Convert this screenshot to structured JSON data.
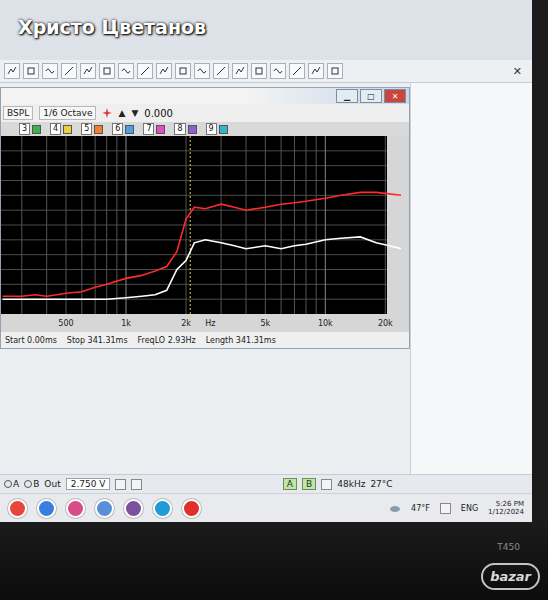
{
  "watermark": {
    "text": "Христо Цветанов"
  },
  "app": {
    "close": "✕"
  },
  "graph_window": {
    "controls": [
      "▁",
      "□",
      "✕"
    ],
    "toolbar": {
      "mode": "BSPL",
      "smoothing": "1/6 Octave",
      "arrows": [
        "▲",
        "▼"
      ],
      "value": "0.000"
    },
    "legend": [
      {
        "label": "3",
        "color": "#3cb44b"
      },
      {
        "label": "4",
        "color": "#e6d23c"
      },
      {
        "label": "5",
        "color": "#f08030"
      },
      {
        "label": "6",
        "color": "#4aa0e8"
      },
      {
        "label": "7",
        "color": "#e050c0"
      },
      {
        "label": "8",
        "color": "#9060d0"
      },
      {
        "label": "9",
        "color": "#30b8c8"
      }
    ],
    "chart": {
      "ticks": [
        {
          "label": "500",
          "hz": 500
        },
        {
          "label": "1k",
          "hz": 1000
        },
        {
          "label": "2k",
          "hz": 2000
        },
        {
          "label": "Hz",
          "hz": 2650
        },
        {
          "label": "5k",
          "hz": 5000
        },
        {
          "label": "10k",
          "hz": 10000
        },
        {
          "label": "20k",
          "hz": 20000
        }
      ],
      "cursor_hz": 2100,
      "frequencies_hz": [
        240,
        300,
        350,
        400,
        450,
        500,
        600,
        700,
        800,
        1000,
        1200,
        1400,
        1600,
        1800,
        2000,
        2200,
        2500,
        3000,
        3500,
        4000,
        5000,
        6000,
        7000,
        8000,
        10000,
        12000,
        15000,
        18000,
        21000,
        24000
      ],
      "series": [
        {
          "color": "#ff2a2a",
          "values": [
            46,
            46,
            46.5,
            46,
            46.5,
            47,
            47.5,
            49,
            50,
            52,
            53,
            54.5,
            56,
            61,
            72,
            76,
            75.5,
            77,
            76,
            75,
            76,
            77,
            77.5,
            78,
            79,
            80,
            81,
            81,
            80.5,
            80
          ]
        },
        {
          "color": "#ffffff",
          "values": [
            45,
            45,
            45,
            45,
            45,
            45,
            45,
            45,
            45,
            45.5,
            46,
            46.5,
            48,
            55,
            58,
            64,
            65,
            64,
            63,
            62,
            63,
            62,
            63,
            63.5,
            65,
            65.5,
            66,
            64,
            63,
            62
          ]
        }
      ]
    },
    "status": [
      "Start 0.00ms",
      "Stop 341.31ms",
      "FreqLO 2.93Hz",
      "Length 341.31ms"
    ]
  },
  "status_bar": {
    "channels": [
      "A",
      "B"
    ],
    "output_label": "Out",
    "output_level": "2.750 V",
    "inputs": [
      {
        "label": "A",
        "selected": true
      },
      {
        "label": "B",
        "selected": true
      }
    ],
    "rate": "48kHz",
    "temperature": "27°C"
  },
  "taskbar": {
    "weather": "47°F",
    "language": "ENG",
    "time": "5:26 PM",
    "date": "1/12/2024"
  },
  "bezel": {
    "model": "T450"
  },
  "logo": {
    "text": "bazar"
  }
}
